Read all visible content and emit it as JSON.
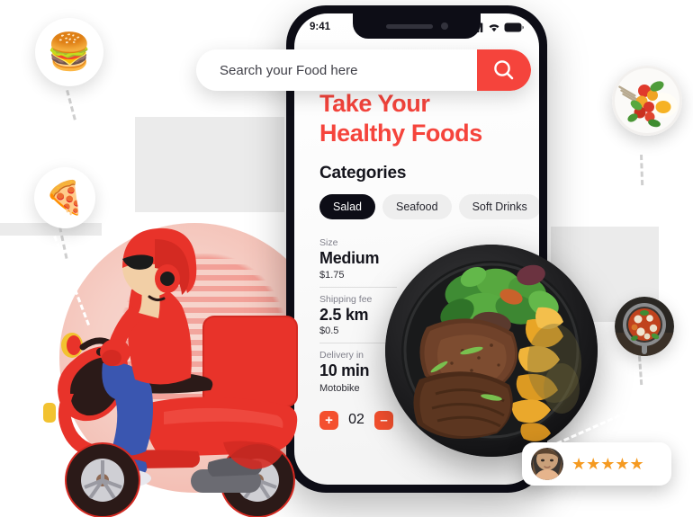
{
  "phone": {
    "status": {
      "time": "9:41",
      "signal_icon": "cellular-signal-icon",
      "wifi_icon": "wifi-icon",
      "battery_icon": "battery-icon"
    }
  },
  "search": {
    "placeholder": "Search your Food here",
    "value": "",
    "button_icon": "search-icon"
  },
  "hero": {
    "headline_line1": "Take Your",
    "headline_line2": "Healthy Foods",
    "headline_color": "#F5443C"
  },
  "categories": {
    "title": "Categories",
    "chips": [
      {
        "label": "Salad",
        "active": true
      },
      {
        "label": "Seafood",
        "active": false
      },
      {
        "label": "Soft Drinks",
        "active": false
      }
    ]
  },
  "details": [
    {
      "label": "Size",
      "value": "Medium",
      "sub": "$1.75"
    },
    {
      "label": "Shipping fee",
      "value": "2.5 km",
      "sub": "$0.5"
    },
    {
      "label": "Delivery in",
      "value": "10 min",
      "sub": "Motobike"
    }
  ],
  "stepper": {
    "increase_label": "+",
    "quantity": "02",
    "decrease_label": "–"
  },
  "rating": {
    "stars": "★★★★★",
    "star_count": 5,
    "star_color": "#F59A21",
    "avatar_name": "reviewer-avatar"
  },
  "bubbles": [
    {
      "name": "burger-bubble",
      "emoji": "🍔"
    },
    {
      "name": "pizza-bubble",
      "emoji": "🍕"
    }
  ],
  "photos": [
    {
      "name": "breakfast-plate-photo"
    },
    {
      "name": "skillet-dish-photo"
    }
  ],
  "illustration": {
    "name": "delivery-scooter-rider",
    "accent": "#E03127"
  },
  "theme": {
    "brand_red": "#F5443C",
    "stepper_orange": "#F4502E",
    "dark": "#0D0D16",
    "chip_gray": "#EEEEEE"
  }
}
